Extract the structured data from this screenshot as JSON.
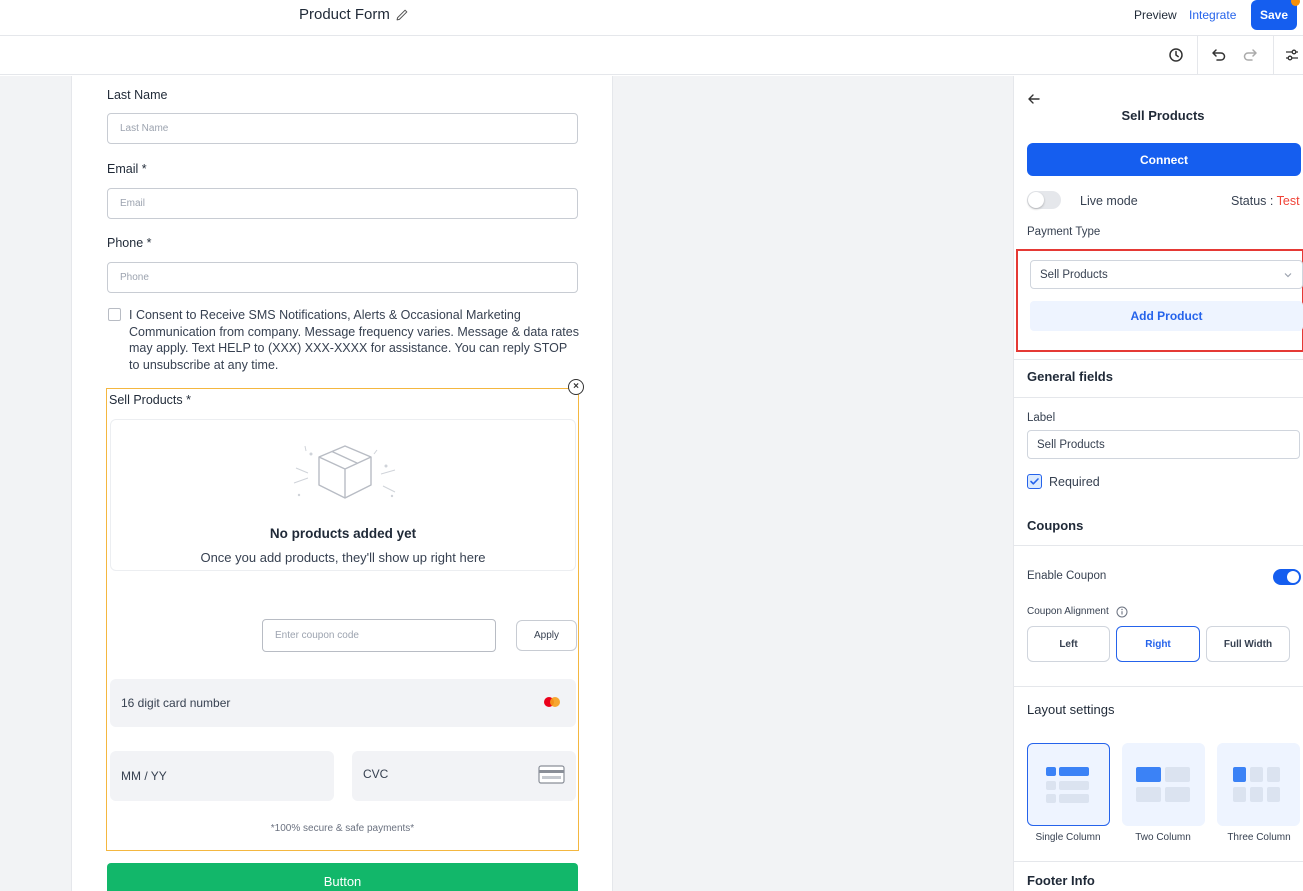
{
  "topbar": {
    "form_title": "Product Form",
    "preview": "Preview",
    "integrate": "Integrate",
    "save": "Save"
  },
  "form": {
    "last_name": {
      "label": "Last Name",
      "placeholder": "Last Name"
    },
    "email": {
      "label": "Email *",
      "placeholder": "Email"
    },
    "phone": {
      "label": "Phone *",
      "placeholder": "Phone"
    },
    "consent_text": "I Consent to Receive SMS Notifications, Alerts & Occasional Marketing Communication from company. Message frequency varies. Message & data rates may apply. Text HELP to (XXX) XXX-XXXX for assistance. You can reply STOP to unsubscribe at any time.",
    "sell_products": {
      "label": "Sell Products *",
      "empty_title": "No products added yet",
      "empty_sub": "Once you add products, they'll show up right here",
      "coupon_placeholder": "Enter coupon code",
      "apply": "Apply",
      "card_number": "16 digit card number",
      "expiry": "MM / YY",
      "cvc": "CVC",
      "secure_note": "*100% secure & safe payments*"
    },
    "submit": "Button"
  },
  "panel": {
    "title": "Sell Products",
    "connect": "Connect",
    "live_mode": "Live mode",
    "live_mode_on": false,
    "status_label": "Status : ",
    "status_value": "Test",
    "payment_type_label": "Payment Type",
    "payment_type_value": "Sell Products",
    "add_product": "Add Product",
    "general_fields": "General fields",
    "label_title": "Label",
    "label_value": "Sell Products",
    "required": "Required",
    "required_checked": true,
    "coupons": "Coupons",
    "enable_coupon": "Enable Coupon",
    "enable_coupon_on": true,
    "coupon_alignment": "Coupon Alignment",
    "alignment_options": [
      "Left",
      "Right",
      "Full Width"
    ],
    "alignment_selected": "Right",
    "layout_settings": "Layout settings",
    "layout_options": [
      "Single Column",
      "Two Column",
      "Three Column"
    ],
    "layout_selected": "Single Column",
    "footer_info": "Footer Info"
  },
  "colors": {
    "primary": "#155eef",
    "success": "#12b76a",
    "status_test": "#f04438",
    "highlight": "#e53935",
    "selected_block": "#f4b740"
  },
  "icons": [
    "pencil-icon",
    "history-icon",
    "undo-icon",
    "redo-icon",
    "settings-sliders-icon",
    "back-arrow-icon",
    "chevron-down-icon",
    "info-icon",
    "check-icon",
    "mastercard-icon",
    "card-icon",
    "box-icon",
    "close-icon"
  ]
}
